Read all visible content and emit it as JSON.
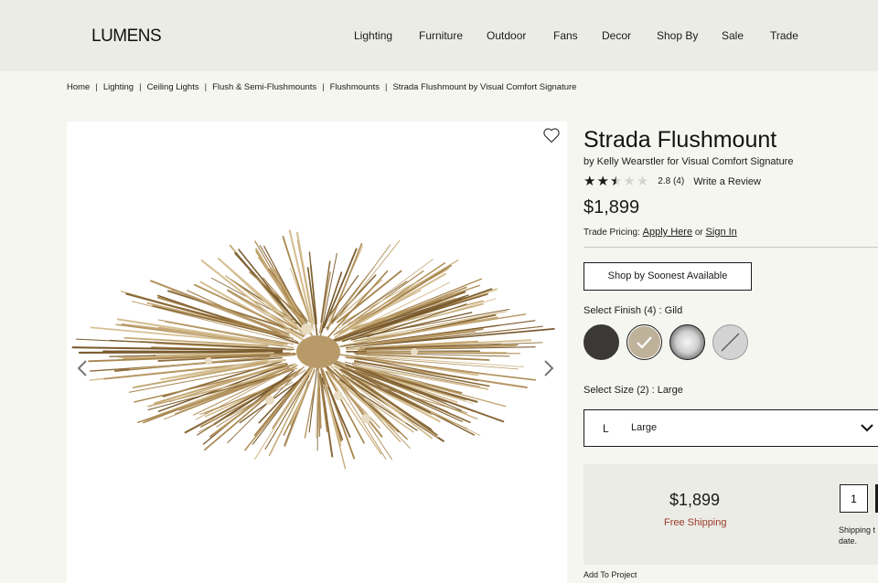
{
  "header": {
    "logo": "LUMENS",
    "nav": [
      "Lighting",
      "Furniture",
      "Outdoor",
      "Fans",
      "Decor",
      "Shop By",
      "Sale",
      "Trade"
    ]
  },
  "breadcrumb": [
    "Home",
    "Lighting",
    "Ceiling Lights",
    "Flush & Semi-Flushmounts",
    "Flushmounts",
    "Strada Flushmount by Visual Comfort Signature"
  ],
  "product": {
    "title": "Strada Flushmount",
    "byline": "by Kelly Wearstler for Visual Comfort Signature",
    "rating": {
      "stars_filled": 2.5,
      "stars_total": 5,
      "text": "2.8",
      "count": "(4)",
      "write_review": "Write a Review"
    },
    "price": "$1,899",
    "trade": {
      "prefix": "Trade Pricing:",
      "apply": "Apply Here",
      "or": "or",
      "sign_in": "Sign In"
    },
    "soonest_button": "Shop by Soonest Available",
    "finish": {
      "label": "Select Finish (4) : Gild",
      "selected_index": 1,
      "swatches": [
        {
          "name": "dark-bronze-swatch",
          "color": "#3b3936"
        },
        {
          "name": "gild-swatch",
          "color": "#bfb29a"
        },
        {
          "name": "chrome-swatch",
          "color": "#cfcfcf"
        },
        {
          "name": "unavailable-swatch",
          "color": "#cfcfd0"
        }
      ]
    },
    "size": {
      "label": "Select Size (2) : Large",
      "code": "L",
      "name": "Large"
    },
    "cart": {
      "price": "$1,899",
      "free_shipping": "Free Shipping",
      "quantity": "1",
      "ship_note_line1": "Shipping t",
      "ship_note_line2": "date."
    },
    "add_to_project": "Add To Project"
  },
  "icons": {
    "heart": "heart-icon",
    "prev": "chevron-left-icon",
    "next": "chevron-right-icon",
    "dropdown": "chevron-down-icon",
    "check": "check-icon"
  }
}
